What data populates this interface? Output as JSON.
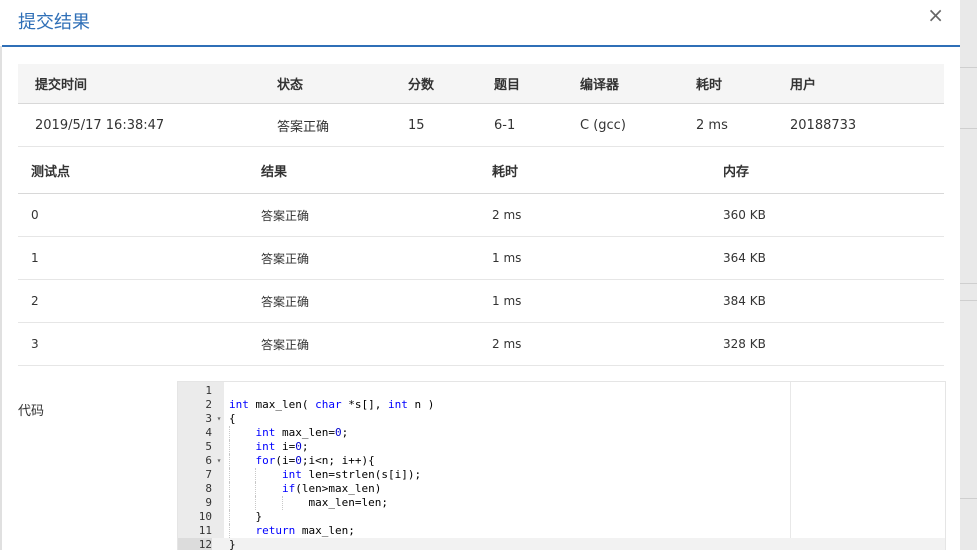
{
  "dialog": {
    "title": "提交结果",
    "close_label": "×"
  },
  "summary": {
    "headers": [
      "提交时间",
      "状态",
      "分数",
      "题目",
      "编译器",
      "耗时",
      "用户"
    ],
    "row": {
      "time": "2019/5/17 16:38:47",
      "status": "答案正确",
      "score": "15",
      "problem": "6-1",
      "compiler": "C (gcc)",
      "duration": "2 ms",
      "user": "20188733"
    }
  },
  "cases": {
    "headers": [
      "测试点",
      "结果",
      "耗时",
      "内存"
    ],
    "rows": [
      {
        "id": "0",
        "result": "答案正确",
        "time": "2 ms",
        "memory": "360 KB"
      },
      {
        "id": "1",
        "result": "答案正确",
        "time": "1 ms",
        "memory": "364 KB"
      },
      {
        "id": "2",
        "result": "答案正确",
        "time": "1 ms",
        "memory": "384 KB"
      },
      {
        "id": "3",
        "result": "答案正确",
        "time": "2 ms",
        "memory": "328 KB"
      }
    ]
  },
  "code": {
    "label": "代码",
    "lines": [
      {
        "n": "1",
        "text": ""
      },
      {
        "n": "2",
        "text": "int max_len( char *s[], int n )"
      },
      {
        "n": "3",
        "text": "{",
        "fold": "▾"
      },
      {
        "n": "4",
        "text": "    int max_len=0;"
      },
      {
        "n": "5",
        "text": "    int i=0;"
      },
      {
        "n": "6",
        "text": "    for(i=0;i<n; i++){",
        "fold": "▾"
      },
      {
        "n": "7",
        "text": "        int len=strlen(s[i]);"
      },
      {
        "n": "8",
        "text": "        if(len>max_len)"
      },
      {
        "n": "9",
        "text": "            max_len=len;"
      },
      {
        "n": "10",
        "text": "    }"
      },
      {
        "n": "11",
        "text": "    return max_len;"
      },
      {
        "n": "12",
        "text": "}"
      }
    ]
  },
  "colors": {
    "accent": "#2f6fb7",
    "accepted": "#d9534f",
    "link": "#1f5d9a"
  }
}
